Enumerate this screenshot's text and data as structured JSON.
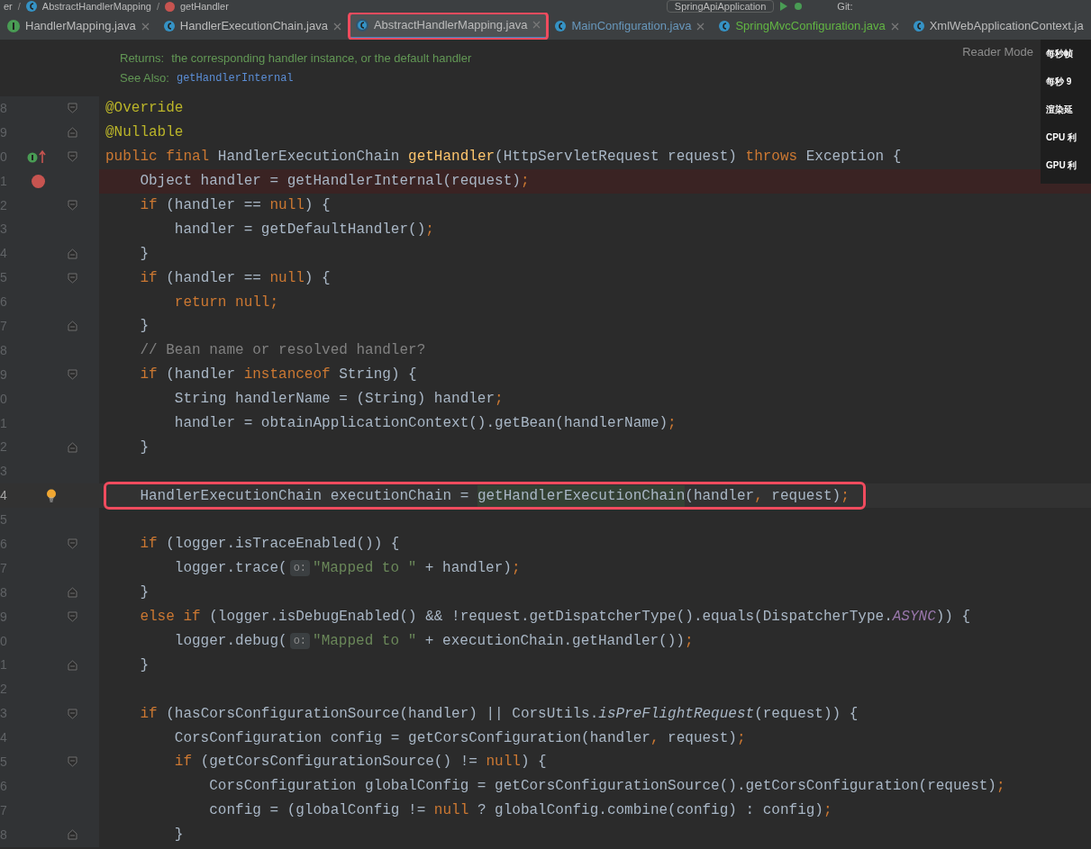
{
  "breadcrumb": [
    {
      "kind": "text",
      "text": "er"
    },
    {
      "kind": "separator",
      "text": "/"
    },
    {
      "kind": "class",
      "text": "AbstractHandlerMapping"
    },
    {
      "kind": "separator",
      "text": "/"
    },
    {
      "kind": "method",
      "text": "getHandler"
    }
  ],
  "toolbar": {
    "run_config": "SpringApiApplication",
    "git_label": "Git:"
  },
  "tabs": [
    {
      "label": "HandlerMapping.java",
      "kind": "interface",
      "color": "#bbbbbb",
      "selected": false,
      "annotated": false
    },
    {
      "label": "HandlerExecutionChain.java",
      "kind": "class",
      "color": "#bbbbbb",
      "selected": false,
      "annotated": false
    },
    {
      "label": "AbstractHandlerMapping.java",
      "kind": "abstract",
      "color": "#bbbbbb",
      "selected": true,
      "annotated": true
    },
    {
      "label": "MainConfiguration.java",
      "kind": "class",
      "color": "#6897bb",
      "selected": false,
      "annotated": false
    },
    {
      "label": "SpringMvcConfiguration.java",
      "kind": "class",
      "color": "#62b543",
      "selected": false,
      "annotated": false
    },
    {
      "label": "XmlWebApplicationContext.ja",
      "kind": "class",
      "color": "#bbbbbb",
      "selected": false,
      "annotated": false
    }
  ],
  "reader_mode": "Reader Mode",
  "perf_overlay": [
    "每秒帧",
    "每秒 9",
    "渲染延",
    "CPU 利",
    "GPU 利"
  ],
  "doc": [
    {
      "label": "Returns:",
      "text": "the corresponding handler instance, or the default handler",
      "kind": "plain"
    },
    {
      "label": "See Also:",
      "text": "getHandlerInternal",
      "kind": "link"
    }
  ],
  "lines": [
    {
      "number": "8",
      "fold_open": true,
      "tokens": [
        {
          "kind": "annotation",
          "text": "@Override"
        }
      ]
    },
    {
      "number": "9",
      "fold_close": true,
      "tokens": [
        {
          "kind": "annotation",
          "text": "@Nullable"
        }
      ]
    },
    {
      "number": "0",
      "fold_open": true,
      "implements": true,
      "tokens": [
        {
          "kind": "keyword",
          "text": "public final "
        },
        {
          "kind": "plain",
          "text": "HandlerExecutionChain "
        },
        {
          "kind": "method",
          "text": "getHandler"
        },
        {
          "kind": "plain",
          "text": "(HttpServletRequest request) "
        },
        {
          "kind": "keyword",
          "text": "throws "
        },
        {
          "kind": "plain",
          "text": "Exception {"
        }
      ]
    },
    {
      "number": "1",
      "breakpoint": true,
      "tokens": [
        {
          "kind": "plain",
          "text": "    Object handler = getHandlerInternal(request)"
        },
        {
          "kind": "keyword",
          "text": ";"
        }
      ]
    },
    {
      "number": "2",
      "fold_open": true,
      "tokens": [
        {
          "kind": "keyword",
          "text": "    if "
        },
        {
          "kind": "plain",
          "text": "(handler == "
        },
        {
          "kind": "keyword",
          "text": "null"
        },
        {
          "kind": "plain",
          "text": ") {"
        }
      ]
    },
    {
      "number": "3",
      "tokens": [
        {
          "kind": "plain",
          "text": "        handler = getDefaultHandler()"
        },
        {
          "kind": "keyword",
          "text": ";"
        }
      ]
    },
    {
      "number": "4",
      "fold_close": true,
      "tokens": [
        {
          "kind": "plain",
          "text": "    }"
        }
      ]
    },
    {
      "number": "5",
      "fold_open": true,
      "tokens": [
        {
          "kind": "keyword",
          "text": "    if "
        },
        {
          "kind": "plain",
          "text": "(handler == "
        },
        {
          "kind": "keyword",
          "text": "null"
        },
        {
          "kind": "plain",
          "text": ") {"
        }
      ]
    },
    {
      "number": "6",
      "tokens": [
        {
          "kind": "keyword",
          "text": "        return null;"
        }
      ]
    },
    {
      "number": "7",
      "fold_close": true,
      "tokens": [
        {
          "kind": "plain",
          "text": "    }"
        }
      ]
    },
    {
      "number": "8",
      "tokens": [
        {
          "kind": "comment",
          "text": "    // Bean name or resolved handler?"
        }
      ]
    },
    {
      "number": "9",
      "fold_open": true,
      "tokens": [
        {
          "kind": "keyword",
          "text": "    if "
        },
        {
          "kind": "plain",
          "text": "(handler "
        },
        {
          "kind": "keyword",
          "text": "instanceof "
        },
        {
          "kind": "plain",
          "text": "String) {"
        }
      ]
    },
    {
      "number": "0",
      "tokens": [
        {
          "kind": "plain",
          "text": "        String handlerName = (String) handler"
        },
        {
          "kind": "keyword",
          "text": ";"
        }
      ]
    },
    {
      "number": "1",
      "tokens": [
        {
          "kind": "plain",
          "text": "        handler = obtainApplicationContext().getBean(handlerName)"
        },
        {
          "kind": "keyword",
          "text": ";"
        }
      ]
    },
    {
      "number": "2",
      "fold_close": true,
      "tokens": [
        {
          "kind": "plain",
          "text": "    }"
        }
      ]
    },
    {
      "number": "3"
    },
    {
      "number": "4",
      "current": true,
      "bulb": true,
      "annotated": true,
      "tokens": [
        {
          "kind": "plain",
          "text": "    HandlerExecutionChain executionChain = "
        },
        {
          "kind": "usage",
          "text": "getHandlerExecutionChain"
        },
        {
          "kind": "plain",
          "text": "(handler"
        },
        {
          "kind": "keyword",
          "text": ", "
        },
        {
          "kind": "plain",
          "text": "request)"
        },
        {
          "kind": "keyword",
          "text": ";"
        }
      ]
    },
    {
      "number": "5"
    },
    {
      "number": "6",
      "fold_open": true,
      "tokens": [
        {
          "kind": "keyword",
          "text": "    if "
        },
        {
          "kind": "plain",
          "text": "(logger.isTraceEnabled()) {"
        }
      ]
    },
    {
      "number": "7",
      "tokens": [
        {
          "kind": "plain",
          "text": "        logger.trace("
        },
        {
          "kind": "hint",
          "text": "o:"
        },
        {
          "kind": "string",
          "text": "\"Mapped to \""
        },
        {
          "kind": "plain",
          "text": " + handler)"
        },
        {
          "kind": "keyword",
          "text": ";"
        }
      ]
    },
    {
      "number": "8",
      "fold_close": true,
      "tokens": [
        {
          "kind": "plain",
          "text": "    }"
        }
      ]
    },
    {
      "number": "9",
      "fold_open": true,
      "tokens": [
        {
          "kind": "keyword",
          "text": "    else if "
        },
        {
          "kind": "plain",
          "text": "(logger.isDebugEnabled() && !request.getDispatcherType().equals(DispatcherType."
        },
        {
          "kind": "constant",
          "text": "ASYNC"
        },
        {
          "kind": "plain",
          "text": ")) {"
        }
      ]
    },
    {
      "number": "0",
      "tokens": [
        {
          "kind": "plain",
          "text": "        logger.debug("
        },
        {
          "kind": "hint",
          "text": "o:"
        },
        {
          "kind": "string",
          "text": "\"Mapped to \""
        },
        {
          "kind": "plain",
          "text": " + executionChain.getHandler())"
        },
        {
          "kind": "keyword",
          "text": ";"
        }
      ]
    },
    {
      "number": "1",
      "fold_close": true,
      "tokens": [
        {
          "kind": "plain",
          "text": "    }"
        }
      ]
    },
    {
      "number": "2"
    },
    {
      "number": "3",
      "fold_open": true,
      "tokens": [
        {
          "kind": "keyword",
          "text": "    if "
        },
        {
          "kind": "plain",
          "text": "(hasCorsConfigurationSource(handler) || CorsUtils."
        },
        {
          "kind": "static",
          "text": "isPreFlightRequest"
        },
        {
          "kind": "plain",
          "text": "(request)) {"
        }
      ]
    },
    {
      "number": "4",
      "tokens": [
        {
          "kind": "plain",
          "text": "        CorsConfiguration config = getCorsConfiguration(handler"
        },
        {
          "kind": "keyword",
          "text": ", "
        },
        {
          "kind": "plain",
          "text": "request)"
        },
        {
          "kind": "keyword",
          "text": ";"
        }
      ]
    },
    {
      "number": "5",
      "fold_open": true,
      "tokens": [
        {
          "kind": "keyword",
          "text": "        if "
        },
        {
          "kind": "plain",
          "text": "(getCorsConfigurationSource() != "
        },
        {
          "kind": "keyword",
          "text": "null"
        },
        {
          "kind": "plain",
          "text": ") {"
        }
      ]
    },
    {
      "number": "6",
      "tokens": [
        {
          "kind": "plain",
          "text": "            CorsConfiguration globalConfig = getCorsConfigurationSource().getCorsConfiguration(request)"
        },
        {
          "kind": "keyword",
          "text": ";"
        }
      ]
    },
    {
      "number": "7",
      "tokens": [
        {
          "kind": "plain",
          "text": "            config = (globalConfig != "
        },
        {
          "kind": "keyword",
          "text": "null "
        },
        {
          "kind": "plain",
          "text": "? globalConfig.combine(config) : config)"
        },
        {
          "kind": "keyword",
          "text": ";"
        }
      ]
    },
    {
      "number": "8",
      "fold_close": true,
      "tokens": [
        {
          "kind": "plain",
          "text": "        }"
        }
      ]
    }
  ]
}
